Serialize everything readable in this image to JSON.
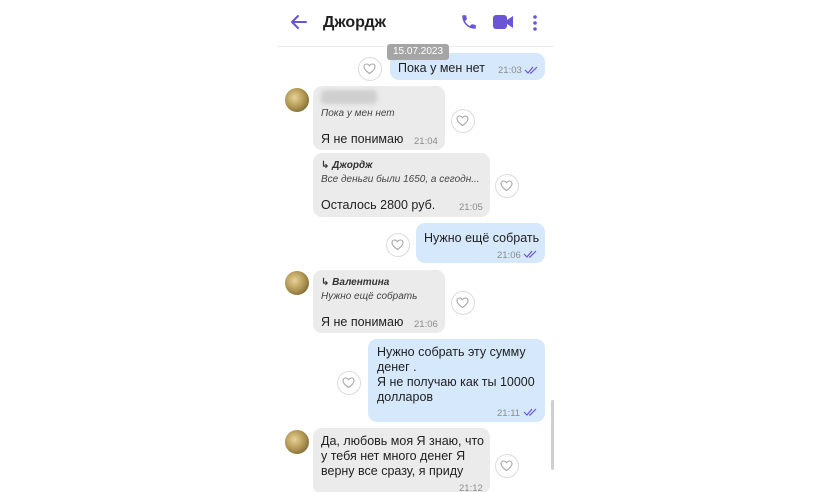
{
  "header": {
    "contact_name": "Джордж"
  },
  "date_chip": "15.07.2023",
  "messages": [
    {
      "text": "Пока  у мен нет",
      "time": "21:03"
    },
    {
      "quote_text": "Пока  у мен нет",
      "text": "Я не понимаю",
      "time": "21:04"
    },
    {
      "quote_author": "↳ Джордж",
      "quote_text": "Все деньги были 1650, а сегодн...",
      "text": "Осталось 2800 руб.",
      "time": "21:05"
    },
    {
      "text": "Нужно ещё собрать",
      "time": "21:06"
    },
    {
      "quote_author": "↳ Валентина",
      "quote_text": "Нужно ещё собрать",
      "text": "Я не понимаю",
      "time": "21:06"
    },
    {
      "lines": [
        "Нужно собрать эту сумму",
        "денег .",
        "Я не получаю как ты 10000",
        "долларов"
      ],
      "time": "21:11"
    },
    {
      "lines": [
        "Да, любовь моя Я знаю, что",
        "у тебя нет много денег Я",
        "верну все сразу, я приду"
      ],
      "time": "21:12"
    }
  ],
  "colors": {
    "accent": "#6b55d6",
    "incoming_bubble": "#ebebeb",
    "outgoing_bubble": "#d6e8fb"
  },
  "icons": [
    "back-arrow-icon",
    "phone-icon",
    "video-camera-icon",
    "more-vertical-icon",
    "heart-icon",
    "double-check-icon"
  ]
}
